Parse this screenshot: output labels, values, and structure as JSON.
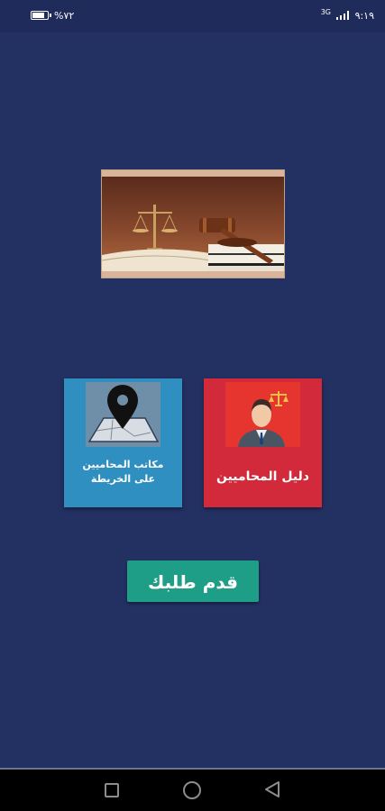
{
  "status_bar": {
    "battery_percent": "%٧٢",
    "battery_level": 0.72,
    "network": "3G",
    "time": "٩:١٩"
  },
  "hero_image": {
    "icon": "law-scales-gavel-image"
  },
  "tiles": {
    "map": {
      "line1": "مكاتب المحاميين",
      "line2": "على الخريطة",
      "icon": "map-pin-icon",
      "color": "#2f8fc0"
    },
    "directory": {
      "label": "دليل المحاميين",
      "icon": "lawyer-avatar-icon",
      "color": "#d22a3a"
    }
  },
  "submit": {
    "label": "قدم طلبك",
    "color": "#1f9e87"
  },
  "nav_bar": {
    "icons": [
      "recents-icon",
      "home-icon",
      "back-icon"
    ]
  },
  "colors": {
    "background": "#233062"
  }
}
